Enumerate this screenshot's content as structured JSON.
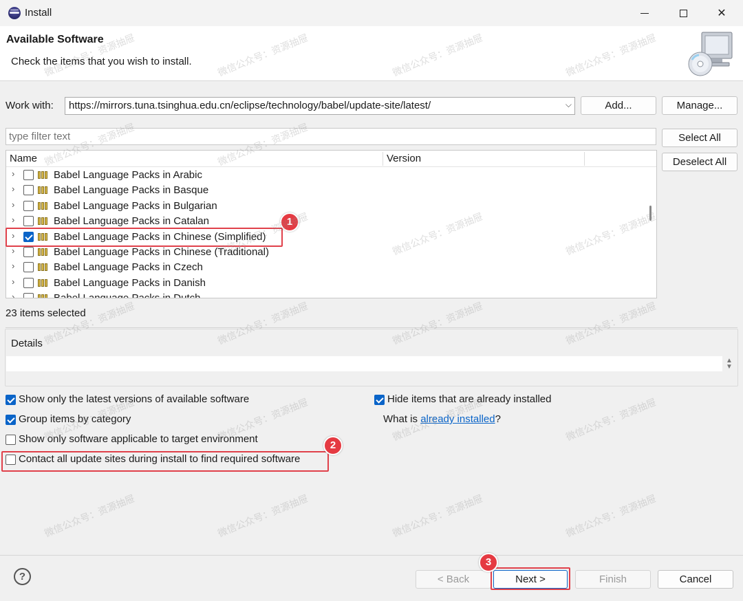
{
  "window": {
    "title": "Install",
    "icon": "eclipse-icon",
    "controls": [
      "minimize-icon",
      "maximize-icon",
      "close-icon"
    ]
  },
  "banner": {
    "heading": "Available Software",
    "description": "Check the items that you wish to install."
  },
  "work_with": {
    "label": "Work with:",
    "value": "https://mirrors.tuna.tsinghua.edu.cn/eclipse/technology/babel/update-site/latest/",
    "add_label": "Add...",
    "manage_label": "Manage..."
  },
  "filter": {
    "placeholder": "type filter text"
  },
  "side_buttons": {
    "select_all": "Select All",
    "deselect_all": "Deselect All"
  },
  "tree": {
    "columns": [
      "Name",
      "Version"
    ],
    "items": [
      {
        "label": "Babel Language Packs in Arabic",
        "checked": false
      },
      {
        "label": "Babel Language Packs in Basque",
        "checked": false
      },
      {
        "label": "Babel Language Packs in Bulgarian",
        "checked": false
      },
      {
        "label": "Babel Language Packs in Catalan",
        "checked": false
      },
      {
        "label": "Babel Language Packs in Chinese (Simplified)",
        "checked": true
      },
      {
        "label": "Babel Language Packs in Chinese (Traditional)",
        "checked": false
      },
      {
        "label": "Babel Language Packs in Czech",
        "checked": false
      },
      {
        "label": "Babel Language Packs in Danish",
        "checked": false
      },
      {
        "label": "Babel Language Packs in Dutch",
        "checked": false
      }
    ]
  },
  "status": "23 items selected",
  "details": {
    "label": "Details"
  },
  "options": {
    "latest_versions": {
      "label": "Show only the latest versions of available software",
      "checked": true
    },
    "group_by_category": {
      "label": "Group items by category",
      "checked": true
    },
    "applicable_target": {
      "label": "Show only software applicable to target environment",
      "checked": false
    },
    "contact_sites": {
      "label": "Contact all update sites during install to find required software",
      "checked": false
    },
    "hide_installed": {
      "label": "Hide items that are already installed",
      "checked": true
    },
    "what_is_prefix": "What is ",
    "what_is_link": "already installed",
    "what_is_suffix": "?"
  },
  "footer": {
    "help_glyph": "?",
    "back_label": "< Back",
    "next_label": "Next >",
    "finish_label": "Finish",
    "cancel_label": "Cancel"
  },
  "annotations": [
    "1",
    "2",
    "3"
  ],
  "watermark": "微信公众号：资源抽屉",
  "colors": {
    "accent": "#0a64c8",
    "highlight": "#e0404a",
    "badge": "#e53a42"
  }
}
